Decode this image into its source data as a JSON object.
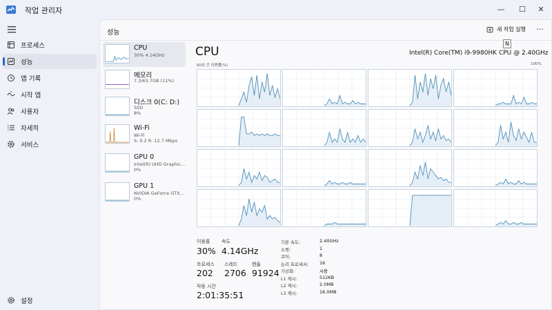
{
  "window": {
    "title": "작업 관리자",
    "minimize_glyph": "—",
    "maximize_glyph": "☐",
    "close_glyph": "✕"
  },
  "sidebar": {
    "items": [
      {
        "label": "프로세스",
        "icon": "processes-icon"
      },
      {
        "label": "성능",
        "icon": "performance-icon",
        "active": true
      },
      {
        "label": "앱 기록",
        "icon": "app-history-icon"
      },
      {
        "label": "시작 앱",
        "icon": "startup-icon"
      },
      {
        "label": "사용자",
        "icon": "users-icon"
      },
      {
        "label": "자세히",
        "icon": "details-icon"
      },
      {
        "label": "서비스",
        "icon": "services-icon"
      }
    ],
    "settings_label": "설정"
  },
  "header": {
    "title": "성능",
    "new_task_label": "새 작업 실행",
    "more_glyph": "···",
    "tooltip": "N"
  },
  "devices": [
    {
      "name": "CPU",
      "line1": "30%  4.14GHz",
      "line2": ""
    },
    {
      "name": "메모리",
      "line1": "7.3/63.7GB (11%)",
      "line2": ""
    },
    {
      "name": "디스크 0(C: D:)",
      "line1": "SSD",
      "line2": "8%"
    },
    {
      "name": "Wi-Fi",
      "line1": "Wi-Fi",
      "line2": "S: 0.2  R: 12.7 Mbps"
    },
    {
      "name": "GPU 0",
      "line1": "Intel(R) UHD Graphics...",
      "line2": "0%"
    },
    {
      "name": "GPU 1",
      "line1": "NVIDIA GeForce GTX...",
      "line2": "0%"
    }
  ],
  "cpu": {
    "title": "CPU",
    "model": "Intel(R) Core(TM) i9-9980HK CPU @ 2.40GHz",
    "graph_caption": "60초 간 이용률(%)",
    "graph_max": "100%",
    "core_count": 16,
    "stats": {
      "utilization_label": "이용률",
      "utilization_value": "30%",
      "speed_label": "속도",
      "speed_value": "4.14GHz",
      "processes_label": "프로세스",
      "processes_value": "202",
      "threads_label": "스레드",
      "threads_value": "2706",
      "handles_label": "핸들",
      "handles_value": "91924",
      "uptime_label": "작동 시간",
      "uptime_value": "2:01:35:51"
    },
    "specs": [
      {
        "label": "기본 속도:",
        "value": "2.40GHz"
      },
      {
        "label": "소켓:",
        "value": "1"
      },
      {
        "label": "코어:",
        "value": "8"
      },
      {
        "label": "논리 프로세서:",
        "value": "16"
      },
      {
        "label": "가상화:",
        "value": "사용"
      },
      {
        "label": "L1 캐시:",
        "value": "512KB"
      },
      {
        "label": "L2 캐시:",
        "value": "2.0MB"
      },
      {
        "label": "L3 캐시:",
        "value": "16.0MB"
      }
    ]
  },
  "colors": {
    "accent": "#2a64c5",
    "cpu_line": "#4f8fb8",
    "cpu_fill": "#dbe8f3",
    "grid_line": "#dfe8f0"
  }
}
